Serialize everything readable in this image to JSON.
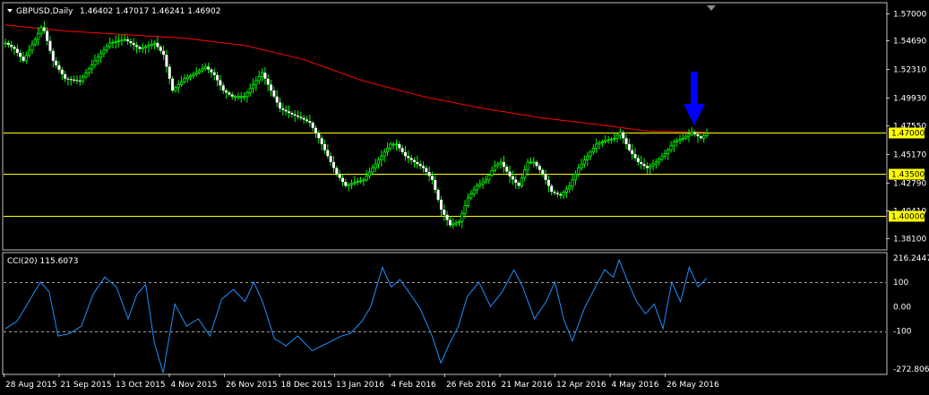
{
  "header": {
    "symbol_label": "GBPUSD,Daily",
    "ohlc": "1.46402 1.47017 1.46241 1.46902"
  },
  "indicator": {
    "label": "CCI(20) 115.6073"
  },
  "colors": {
    "background": "#000000",
    "bull_candle": "#00ff00",
    "moving_average": "#ff0000",
    "level_line": "#ffff00",
    "level_tag": "#ffff00",
    "cci_line": "#1e90ff",
    "arrow": "#0000ff",
    "frame": "#c0c0c0"
  },
  "icons": {
    "dropdown": "triangle-down-icon",
    "marker": "down-arrow-icon"
  },
  "chart_data": {
    "type": "candlestick",
    "price_axis": {
      "ticks": [
        "1.57000",
        "1.54690",
        "1.52310",
        "1.49930",
        "1.47550",
        "1.45170",
        "1.42790",
        "1.40410",
        "1.38100"
      ],
      "ylim": [
        1.372,
        1.578
      ]
    },
    "levels": [
      {
        "label": "1.47000",
        "value": 1.47
      },
      {
        "label": "1.43500",
        "value": 1.435
      },
      {
        "label": "1.40000",
        "value": 1.4
      }
    ],
    "date_ticks": [
      "28 Aug 2015",
      "21 Sep 2015",
      "13 Oct 2015",
      "4 Nov 2015",
      "26 Nov 2015",
      "18 Dec 2015",
      "13 Jan 2016",
      "4 Feb 2016",
      "26 Feb 2016",
      "21 Mar 2016",
      "12 Apr 2016",
      "4 May 2016",
      "26 May 2016"
    ],
    "close_anchors": [
      [
        0,
        1.545
      ],
      [
        3,
        1.54
      ],
      [
        6,
        1.53
      ],
      [
        10,
        1.548
      ],
      [
        12,
        1.558
      ],
      [
        13,
        1.555
      ],
      [
        16,
        1.53
      ],
      [
        20,
        1.515
      ],
      [
        25,
        1.513
      ],
      [
        30,
        1.53
      ],
      [
        35,
        1.545
      ],
      [
        40,
        1.548
      ],
      [
        45,
        1.54
      ],
      [
        50,
        1.545
      ],
      [
        53,
        1.535
      ],
      [
        56,
        1.505
      ],
      [
        60,
        1.515
      ],
      [
        64,
        1.52
      ],
      [
        67,
        1.525
      ],
      [
        70,
        1.518
      ],
      [
        73,
        1.505
      ],
      [
        76,
        1.5
      ],
      [
        80,
        1.5
      ],
      [
        83,
        1.51
      ],
      [
        86,
        1.52
      ],
      [
        89,
        1.505
      ],
      [
        92,
        1.49
      ],
      [
        96,
        1.485
      ],
      [
        99,
        1.482
      ],
      [
        102,
        1.478
      ],
      [
        105,
        1.465
      ],
      [
        108,
        1.45
      ],
      [
        111,
        1.435
      ],
      [
        114,
        1.425
      ],
      [
        117,
        1.428
      ],
      [
        120,
        1.43
      ],
      [
        123,
        1.44
      ],
      [
        126,
        1.45
      ],
      [
        129,
        1.46
      ],
      [
        131,
        1.46
      ],
      [
        134,
        1.45
      ],
      [
        137,
        1.445
      ],
      [
        140,
        1.44
      ],
      [
        143,
        1.43
      ],
      [
        146,
        1.405
      ],
      [
        149,
        1.392
      ],
      [
        152,
        1.395
      ],
      [
        155,
        1.415
      ],
      [
        158,
        1.425
      ],
      [
        161,
        1.43
      ],
      [
        164,
        1.442
      ],
      [
        166,
        1.445
      ],
      [
        169,
        1.433
      ],
      [
        172,
        1.425
      ],
      [
        175,
        1.445
      ],
      [
        177,
        1.445
      ],
      [
        180,
        1.435
      ],
      [
        183,
        1.42
      ],
      [
        186,
        1.417
      ],
      [
        189,
        1.425
      ],
      [
        192,
        1.44
      ],
      [
        195,
        1.45
      ],
      [
        198,
        1.46
      ],
      [
        201,
        1.463
      ],
      [
        204,
        1.465
      ],
      [
        206,
        1.47
      ],
      [
        209,
        1.455
      ],
      [
        212,
        1.445
      ],
      [
        215,
        1.44
      ],
      [
        218,
        1.445
      ],
      [
        221,
        1.452
      ],
      [
        224,
        1.462
      ],
      [
        227,
        1.465
      ],
      [
        230,
        1.47
      ],
      [
        233,
        1.465
      ],
      [
        235,
        1.469
      ]
    ],
    "moving_average_anchors": [
      [
        0,
        1.56
      ],
      [
        20,
        1.555
      ],
      [
        40,
        1.552
      ],
      [
        60,
        1.549
      ],
      [
        80,
        1.543
      ],
      [
        100,
        1.531
      ],
      [
        120,
        1.513
      ],
      [
        140,
        1.5
      ],
      [
        160,
        1.49
      ],
      [
        180,
        1.482
      ],
      [
        200,
        1.476
      ],
      [
        215,
        1.471
      ],
      [
        235,
        1.47
      ]
    ],
    "cci_axis": {
      "ticks": [
        "216.2447",
        "100",
        "0.00",
        "-100",
        "-272.8061"
      ],
      "ylim": [
        -272.8061,
        216.2447
      ]
    },
    "cci_anchors": [
      [
        0,
        -90
      ],
      [
        4,
        -60
      ],
      [
        8,
        20
      ],
      [
        12,
        100
      ],
      [
        15,
        60
      ],
      [
        18,
        -120
      ],
      [
        22,
        -110
      ],
      [
        26,
        -80
      ],
      [
        30,
        50
      ],
      [
        34,
        120
      ],
      [
        38,
        80
      ],
      [
        42,
        -50
      ],
      [
        45,
        50
      ],
      [
        48,
        90
      ],
      [
        51,
        -150
      ],
      [
        54,
        -270
      ],
      [
        58,
        10
      ],
      [
        62,
        -80
      ],
      [
        66,
        -50
      ],
      [
        70,
        -120
      ],
      [
        74,
        30
      ],
      [
        78,
        70
      ],
      [
        82,
        20
      ],
      [
        85,
        100
      ],
      [
        88,
        20
      ],
      [
        92,
        -130
      ],
      [
        96,
        -160
      ],
      [
        100,
        -120
      ],
      [
        105,
        -180
      ],
      [
        110,
        -150
      ],
      [
        115,
        -120
      ],
      [
        118,
        -110
      ],
      [
        122,
        -60
      ],
      [
        125,
        0
      ],
      [
        129,
        160
      ],
      [
        132,
        80
      ],
      [
        135,
        110
      ],
      [
        138,
        60
      ],
      [
        142,
        -10
      ],
      [
        146,
        -120
      ],
      [
        149,
        -230
      ],
      [
        152,
        -150
      ],
      [
        155,
        -80
      ],
      [
        158,
        40
      ],
      [
        162,
        100
      ],
      [
        166,
        0
      ],
      [
        170,
        60
      ],
      [
        174,
        150
      ],
      [
        177,
        80
      ],
      [
        181,
        -50
      ],
      [
        185,
        20
      ],
      [
        188,
        100
      ],
      [
        191,
        -50
      ],
      [
        194,
        -140
      ],
      [
        198,
        -10
      ],
      [
        201,
        60
      ],
      [
        205,
        150
      ],
      [
        208,
        120
      ],
      [
        210,
        190
      ],
      [
        213,
        100
      ],
      [
        216,
        20
      ],
      [
        219,
        -30
      ],
      [
        222,
        10
      ],
      [
        225,
        -90
      ],
      [
        228,
        100
      ],
      [
        231,
        20
      ],
      [
        234,
        160
      ],
      [
        237,
        80
      ],
      [
        240,
        116
      ]
    ]
  }
}
